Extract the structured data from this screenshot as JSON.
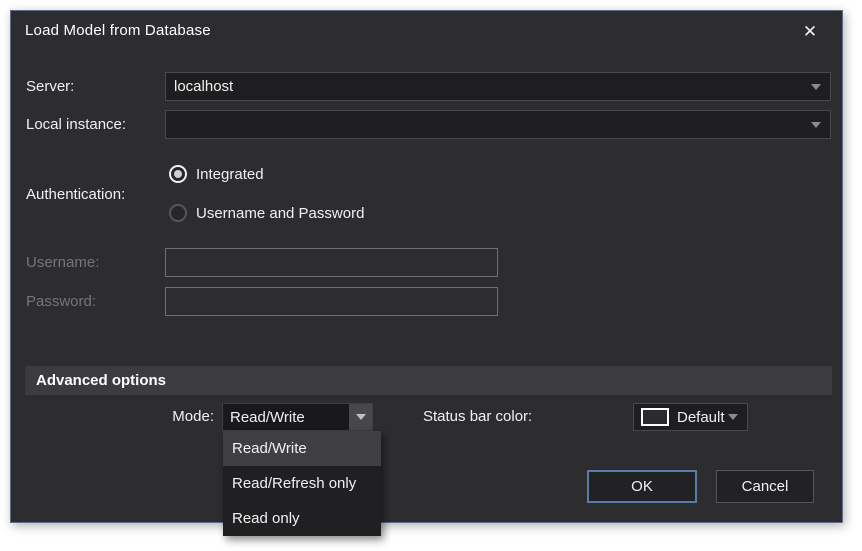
{
  "dialog": {
    "title": "Load Model from Database",
    "close_icon": "✕"
  },
  "fields": {
    "server": {
      "label": "Server:",
      "value": "localhost"
    },
    "local_instance": {
      "label": "Local instance:",
      "value": ""
    },
    "authentication": {
      "label": "Authentication:",
      "options": [
        {
          "label": "Integrated",
          "selected": true
        },
        {
          "label": "Username and Password",
          "selected": false
        }
      ]
    },
    "username": {
      "label": "Username:",
      "value": "",
      "disabled": true
    },
    "password": {
      "label": "Password:",
      "value": "",
      "disabled": true
    }
  },
  "advanced": {
    "header": "Advanced options",
    "mode": {
      "label": "Mode:",
      "value": "Read/Write",
      "options": [
        "Read/Write",
        "Read/Refresh only",
        "Read only"
      ],
      "highlighted_option": "Read/Write"
    },
    "status_bar_color": {
      "label": "Status bar color:",
      "value": "Default",
      "swatch_border": "#ffffff"
    }
  },
  "buttons": {
    "ok": "OK",
    "cancel": "Cancel"
  },
  "colors": {
    "dialog_background": "#2d2d30",
    "dialog_border": "#5e6c88",
    "combo_background": "#1e1e20",
    "advanced_bar_background": "#3c3c40",
    "highlight_item_background": "#3e3e43",
    "ok_focus_border": "#5a7ca8",
    "disabled_text": "#75757a"
  }
}
